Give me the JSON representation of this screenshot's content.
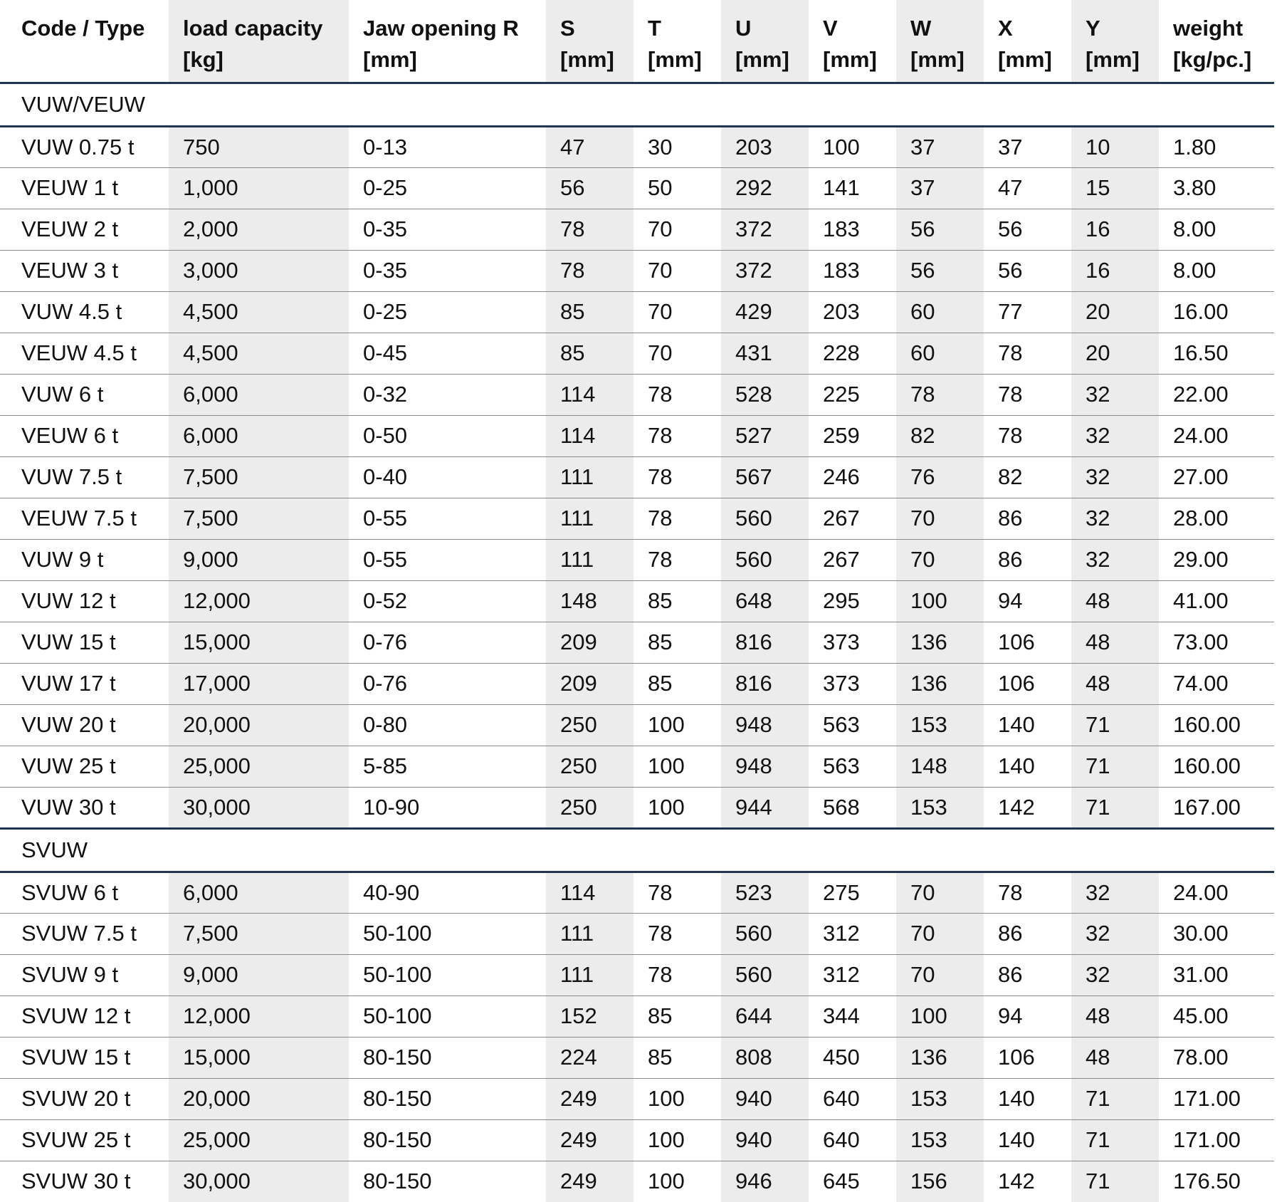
{
  "table": {
    "columns": [
      {
        "label_line1": "Code / Type",
        "label_line2": ""
      },
      {
        "label_line1": "load capacity",
        "label_line2": "[kg]"
      },
      {
        "label_line1": "Jaw opening R",
        "label_line2": "[mm]"
      },
      {
        "label_line1": "S",
        "label_line2": "[mm]"
      },
      {
        "label_line1": "T",
        "label_line2": "[mm]"
      },
      {
        "label_line1": "U",
        "label_line2": "[mm]"
      },
      {
        "label_line1": "V",
        "label_line2": "[mm]"
      },
      {
        "label_line1": "W",
        "label_line2": "[mm]"
      },
      {
        "label_line1": "X",
        "label_line2": "[mm]"
      },
      {
        "label_line1": "Y",
        "label_line2": "[mm]"
      },
      {
        "label_line1": "weight",
        "label_line2": "[kg/pc.]"
      }
    ],
    "groups": [
      {
        "name": "VUW/VEUW",
        "rows": [
          [
            "VUW 0.75 t",
            "750",
            "0-13",
            "47",
            "30",
            "203",
            "100",
            "37",
            "37",
            "10",
            "1.80"
          ],
          [
            "VEUW 1 t",
            "1,000",
            "0-25",
            "56",
            "50",
            "292",
            "141",
            "37",
            "47",
            "15",
            "3.80"
          ],
          [
            "VEUW 2 t",
            "2,000",
            "0-35",
            "78",
            "70",
            "372",
            "183",
            "56",
            "56",
            "16",
            "8.00"
          ],
          [
            "VEUW 3 t",
            "3,000",
            "0-35",
            "78",
            "70",
            "372",
            "183",
            "56",
            "56",
            "16",
            "8.00"
          ],
          [
            "VUW 4.5 t",
            "4,500",
            "0-25",
            "85",
            "70",
            "429",
            "203",
            "60",
            "77",
            "20",
            "16.00"
          ],
          [
            "VEUW 4.5 t",
            "4,500",
            "0-45",
            "85",
            "70",
            "431",
            "228",
            "60",
            "78",
            "20",
            "16.50"
          ],
          [
            "VUW 6 t",
            "6,000",
            "0-32",
            "114",
            "78",
            "528",
            "225",
            "78",
            "78",
            "32",
            "22.00"
          ],
          [
            "VEUW 6 t",
            "6,000",
            "0-50",
            "114",
            "78",
            "527",
            "259",
            "82",
            "78",
            "32",
            "24.00"
          ],
          [
            "VUW 7.5 t",
            "7,500",
            "0-40",
            "111",
            "78",
            "567",
            "246",
            "76",
            "82",
            "32",
            "27.00"
          ],
          [
            "VEUW 7.5 t",
            "7,500",
            "0-55",
            "111",
            "78",
            "560",
            "267",
            "70",
            "86",
            "32",
            "28.00"
          ],
          [
            "VUW 9 t",
            "9,000",
            "0-55",
            "111",
            "78",
            "560",
            "267",
            "70",
            "86",
            "32",
            "29.00"
          ],
          [
            "VUW 12 t",
            "12,000",
            "0-52",
            "148",
            "85",
            "648",
            "295",
            "100",
            "94",
            "48",
            "41.00"
          ],
          [
            "VUW 15 t",
            "15,000",
            "0-76",
            "209",
            "85",
            "816",
            "373",
            "136",
            "106",
            "48",
            "73.00"
          ],
          [
            "VUW 17 t",
            "17,000",
            "0-76",
            "209",
            "85",
            "816",
            "373",
            "136",
            "106",
            "48",
            "74.00"
          ],
          [
            "VUW 20 t",
            "20,000",
            "0-80",
            "250",
            "100",
            "948",
            "563",
            "153",
            "140",
            "71",
            "160.00"
          ],
          [
            "VUW 25 t",
            "25,000",
            "5-85",
            "250",
            "100",
            "948",
            "563",
            "148",
            "140",
            "71",
            "160.00"
          ],
          [
            "VUW 30 t",
            "30,000",
            "10-90",
            "250",
            "100",
            "944",
            "568",
            "153",
            "142",
            "71",
            "167.00"
          ]
        ]
      },
      {
        "name": "SVUW",
        "rows": [
          [
            "SVUW 6 t",
            "6,000",
            "40-90",
            "114",
            "78",
            "523",
            "275",
            "70",
            "78",
            "32",
            "24.00"
          ],
          [
            "SVUW 7.5 t",
            "7,500",
            "50-100",
            "111",
            "78",
            "560",
            "312",
            "70",
            "86",
            "32",
            "30.00"
          ],
          [
            "SVUW 9 t",
            "9,000",
            "50-100",
            "111",
            "78",
            "560",
            "312",
            "70",
            "86",
            "32",
            "31.00"
          ],
          [
            "SVUW 12 t",
            "12,000",
            "50-100",
            "152",
            "85",
            "644",
            "344",
            "100",
            "94",
            "48",
            "45.00"
          ],
          [
            "SVUW 15 t",
            "15,000",
            "80-150",
            "224",
            "85",
            "808",
            "450",
            "136",
            "106",
            "48",
            "78.00"
          ],
          [
            "SVUW 20 t",
            "20,000",
            "80-150",
            "249",
            "100",
            "940",
            "640",
            "153",
            "140",
            "71",
            "171.00"
          ],
          [
            "SVUW 25 t",
            "25,000",
            "80-150",
            "249",
            "100",
            "940",
            "640",
            "153",
            "140",
            "71",
            "171.00"
          ],
          [
            "SVUW 30 t",
            "30,000",
            "80-150",
            "249",
            "100",
            "946",
            "645",
            "156",
            "142",
            "71",
            "176.50"
          ]
        ]
      }
    ]
  },
  "colors": {
    "shade": "#ececec",
    "rule_dark": "#1f3550",
    "rule_light": "#8a8a8a",
    "text": "#111111"
  }
}
